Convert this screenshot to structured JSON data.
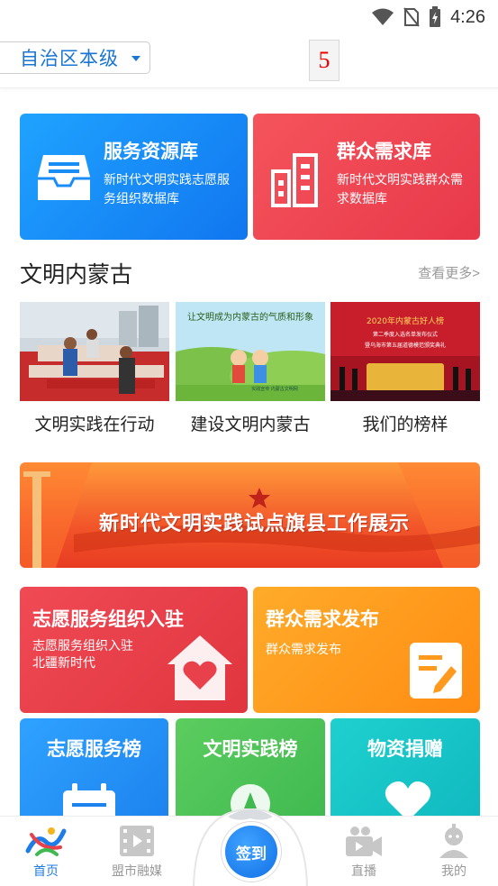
{
  "status_bar": {
    "time": "4:26"
  },
  "header": {
    "region": "自治区本级",
    "badge": "5"
  },
  "resource_cards": [
    {
      "title": "服务资源库",
      "desc": "新时代文明实践志愿服务组织数据库"
    },
    {
      "title": "群众需求库",
      "desc": "新时代文明实践群众需求数据库"
    }
  ],
  "section": {
    "title": "文明内蒙古",
    "more": "查看更多>"
  },
  "thumbs": [
    {
      "caption": "文明实践在行动"
    },
    {
      "caption": "建设文明内蒙古",
      "image_text": "让文明成为内蒙古的气质和形象",
      "image_subtext": "实践宣传 内蒙古文明网"
    },
    {
      "caption": "我们的榜样",
      "image_text": "2020年内蒙古好人榜",
      "image_subtext": "第二季度入选名单发布仪式",
      "image_subtext2": "暨乌海市第五届道德模范颁奖典礼"
    }
  ],
  "banner": {
    "text": "新时代文明实践试点旗县工作展示"
  },
  "tiles": {
    "volunteer_org": {
      "title": "志愿服务组织入驻",
      "desc_line1": "志愿服务组织入驻",
      "desc_line2": "北疆新时代"
    },
    "demand_publish": {
      "title": "群众需求发布",
      "desc": "群众需求发布"
    },
    "volunteer_rank": {
      "title": "志愿服务榜"
    },
    "civil_rank": {
      "title": "文明实践榜"
    },
    "donation": {
      "title": "物资捐赠"
    }
  },
  "bottom_nav": {
    "home": "首页",
    "media": "盟市融媒",
    "checkin": "签到",
    "live": "直播",
    "mine": "我的"
  },
  "colors": {
    "accent": "#1d7ce8",
    "blue_card": "#1176f0",
    "red_card": "#e8384a",
    "orange": "#ff9a1e",
    "green": "#4cc45a",
    "teal": "#17c6c9"
  }
}
